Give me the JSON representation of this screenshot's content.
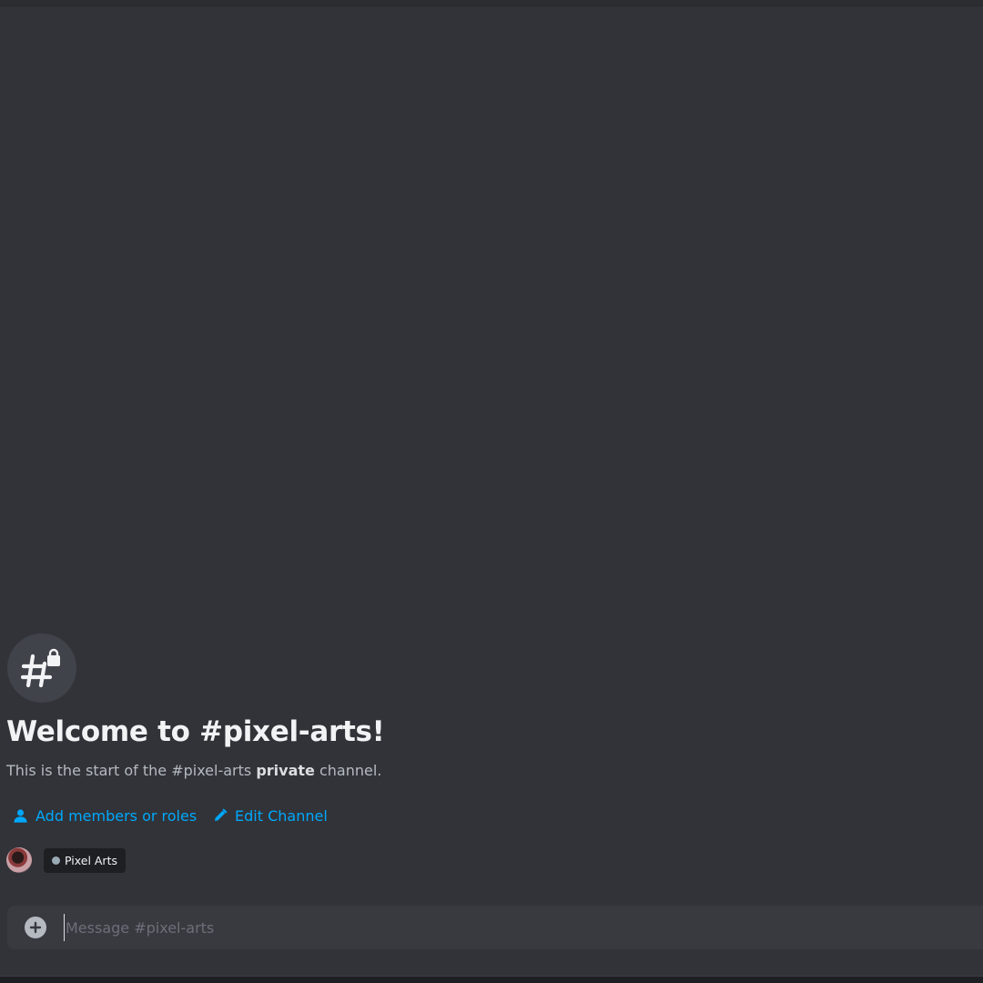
{
  "welcome": {
    "title": "Welcome to #pixel-arts!",
    "sub_before": "This is the start of the #pixel-arts ",
    "sub_bold": "private",
    "sub_after": " channel."
  },
  "actions": {
    "add_members": "Add members or roles",
    "edit_channel": "Edit Channel"
  },
  "role": {
    "name": "Pixel Arts"
  },
  "composer": {
    "placeholder": "Message #pixel-arts"
  },
  "icons": {
    "channel": "hash-lock-icon",
    "add_members": "person-icon",
    "edit": "pencil-icon",
    "attach": "plus-circle-icon"
  },
  "colors": {
    "background": "#313338",
    "link": "#00a8fc",
    "title": "#f2f3f5",
    "muted": "#b5bac1"
  }
}
